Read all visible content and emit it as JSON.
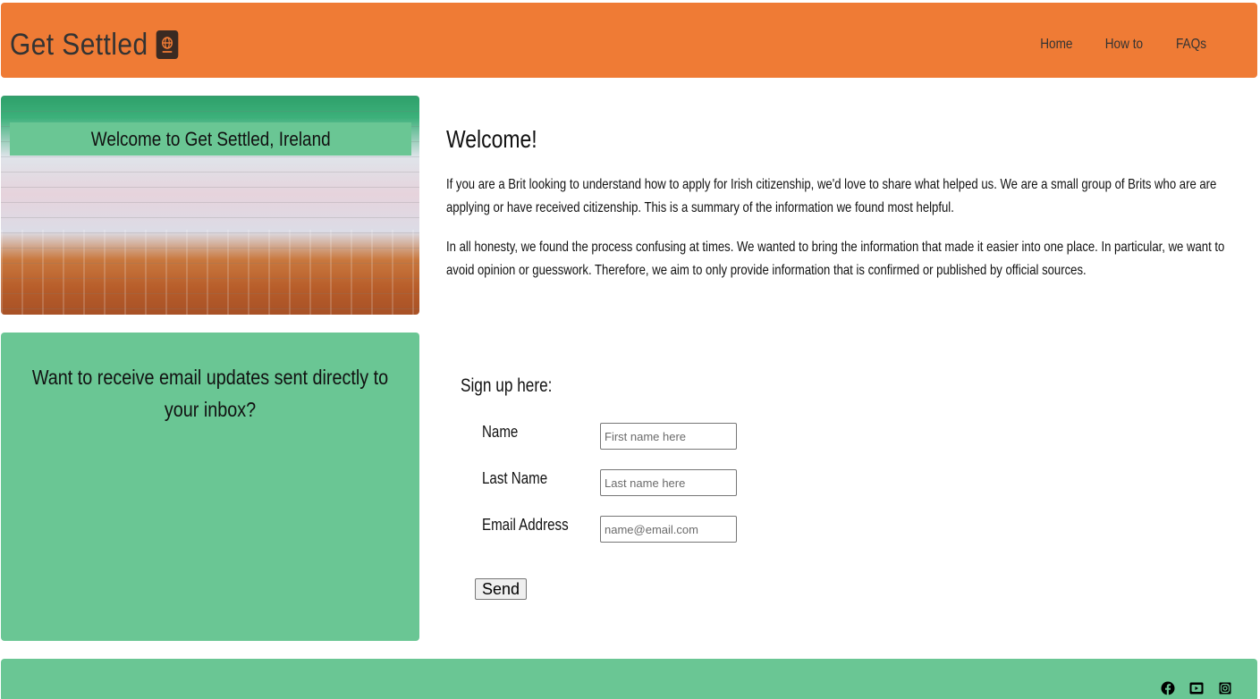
{
  "header": {
    "brand": "Get Settled",
    "brand_icon": "passport-icon",
    "nav": [
      "Home",
      "How to",
      "FAQs"
    ]
  },
  "hero": {
    "banner": "Welcome to Get Settled, Ireland"
  },
  "welcome": {
    "title": "Welcome!",
    "paragraphs": [
      "If you are a Brit looking to understand how to apply for Irish citizenship, we'd love to share what helped us. We are a small group of Brits who are are applying or have received citizenship. This is a summary of the information we found most helpful.",
      "In all honesty, we found the process confusing at times. We wanted to bring the information that made it easier into one place. In particular, we want to avoid opinion or guesswork. Therefore, we aim to only provide information that is confirmed or published by official sources."
    ]
  },
  "signup_card": {
    "heading": "Want to receive email updates sent directly to your inbox?"
  },
  "form": {
    "title": "Sign up here:",
    "fields": [
      {
        "label": "Name",
        "value": "",
        "placeholder": "First name here"
      },
      {
        "label": "Last Name",
        "value": "",
        "placeholder": "Last name here"
      },
      {
        "label": "Email Address",
        "value": "",
        "placeholder": "name@email.com"
      }
    ],
    "submit": "Send"
  },
  "footer": {
    "socials": [
      "facebook-icon",
      "youtube-icon",
      "instagram-icon"
    ]
  },
  "colors": {
    "header_bg": "#ef7b35",
    "accent_green": "#6ac694",
    "text": "#111111"
  }
}
